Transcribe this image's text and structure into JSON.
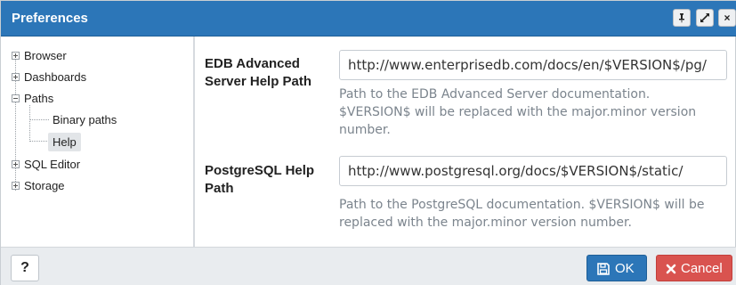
{
  "dialog": {
    "title": "Preferences",
    "title_buttons": [
      {
        "icon": "pin-icon"
      },
      {
        "icon": "expand-icon"
      },
      {
        "icon": "close-icon",
        "glyph": "×"
      }
    ]
  },
  "tree": {
    "items": [
      {
        "label": "Browser",
        "expander": "plus"
      },
      {
        "label": "Dashboards",
        "expander": "plus"
      },
      {
        "label": "Paths",
        "expander": "minus"
      },
      {
        "label": "Binary paths"
      },
      {
        "label": "Help",
        "selected": true
      },
      {
        "label": "SQL Editor",
        "expander": "plus"
      },
      {
        "label": "Storage",
        "expander": "plus"
      }
    ]
  },
  "form": {
    "edb": {
      "label_line1": "EDB Advanced",
      "label_line2": "Server Help Path",
      "value": "http://www.enterprisedb.com/docs/en/$VERSION$/pg/",
      "help_line1": "Path to the EDB Advanced Server documentation.",
      "help_line2": "$VERSION$ will be replaced with the major.minor version",
      "help_line3": "number."
    },
    "postgres": {
      "label_line1": "PostgreSQL Help",
      "label_line2": "Path",
      "value": "http://www.postgresql.org/docs/$VERSION$/static/",
      "help_line1": "Path to the PostgreSQL documentation. $VERSION$ will be",
      "help_line2": "replaced with the major.minor version number."
    }
  },
  "footer": {
    "help_label": "?",
    "ok_label": "OK",
    "cancel_label": "Cancel"
  },
  "colors": {
    "titlebar": "#2c76b8",
    "ok_button": "#2c76b8",
    "cancel_button": "#d9534f"
  }
}
